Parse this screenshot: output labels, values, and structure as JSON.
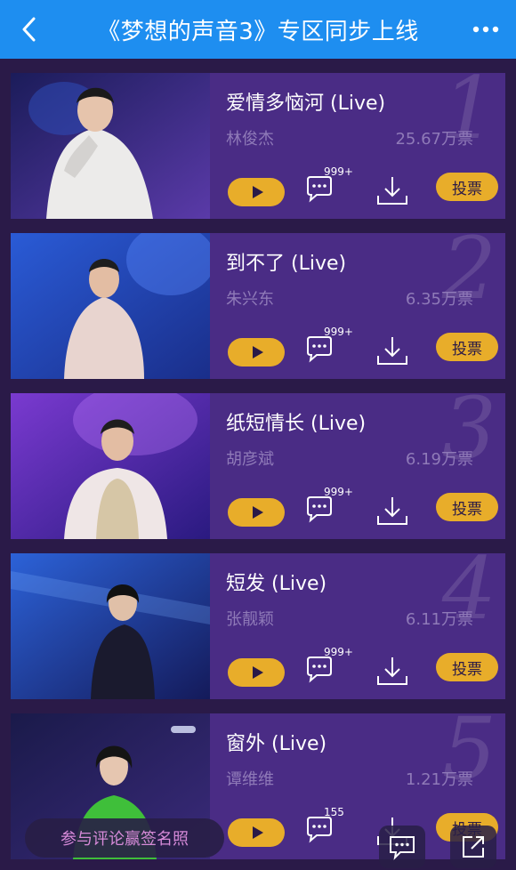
{
  "header": {
    "title": "《梦想的声音3》专区同步上线",
    "back_icon": "chevron-left-icon",
    "more_icon": "more-horizontal-icon"
  },
  "colors": {
    "header_bg": "#1e8ef0",
    "page_bg": "#2a1a48",
    "card_bg": "#4a2c85",
    "accent": "#e8ad2a",
    "muted_text": "#8f7ab8"
  },
  "songs": [
    {
      "rank": "1",
      "title": "爱情多恼河 (Live)",
      "singer": "林俊杰",
      "votes": "25.67万票",
      "comments": "999+",
      "vote_label": "投票"
    },
    {
      "rank": "2",
      "title": "到不了 (Live)",
      "singer": "朱兴东",
      "votes": "6.35万票",
      "comments": "999+",
      "vote_label": "投票"
    },
    {
      "rank": "3",
      "title": "纸短情长 (Live)",
      "singer": "胡彦斌",
      "votes": "6.19万票",
      "comments": "999+",
      "vote_label": "投票"
    },
    {
      "rank": "4",
      "title": "短发 (Live)",
      "singer": "张靓颖",
      "votes": "6.11万票",
      "comments": "999+",
      "vote_label": "投票"
    },
    {
      "rank": "5",
      "title": "窗外 (Live)",
      "singer": "谭维维",
      "votes": "1.21万票",
      "comments": "155",
      "vote_label": "投票"
    }
  ],
  "floating": {
    "banner_text": "参与评论赢签名照",
    "comment_icon": "chat-icon",
    "share_icon": "share-icon"
  }
}
